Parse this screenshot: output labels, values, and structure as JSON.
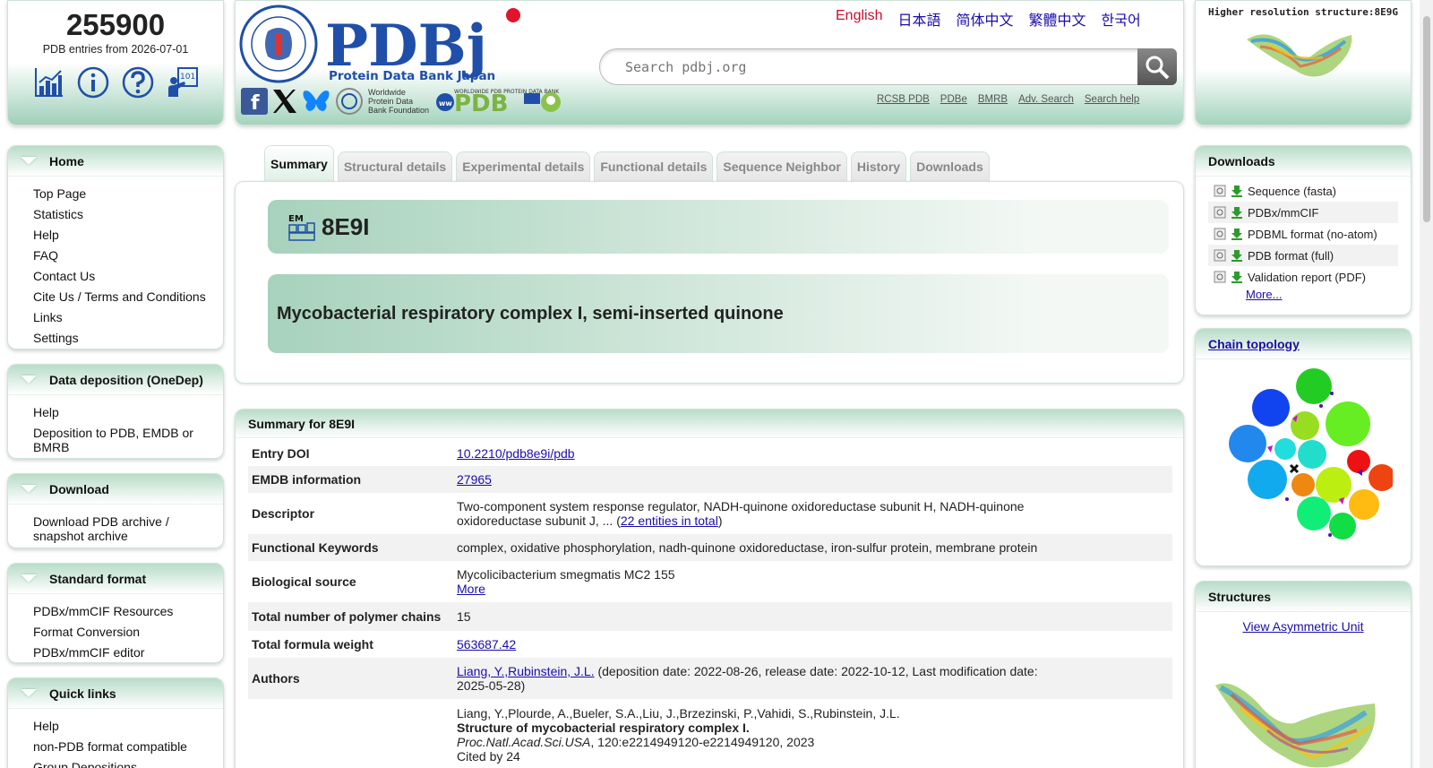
{
  "stats": {
    "count": "255900",
    "subtitle": "PDB entries from 2026-07-01"
  },
  "header": {
    "logo_text": "PDBj",
    "logo_sub": "Protein Data Bank Japan",
    "seal_text": "PROTEIN DATA BANK JAPAN · THE UNIVERSITY OF OSAKA",
    "wwpdb_foundation": "Worldwide Protein Data Bank Foundation",
    "wwpdb_logo": "WORLDWIDE PDB PROTEIN DATA BANK",
    "languages": [
      "English",
      "日本語",
      "简体中文",
      "繁體中文",
      "한국어"
    ],
    "search_placeholder": "Search pdbj.org",
    "sublinks": [
      "RCSB PDB",
      "PDBe",
      "BMRB",
      "Adv. Search",
      "Search help"
    ]
  },
  "hires": {
    "title": "Higher resolution structure:8E9G"
  },
  "menus": [
    {
      "title": "Home",
      "items": [
        "Top Page",
        "Statistics",
        "Help",
        "FAQ",
        "Contact Us",
        "Cite Us / Terms and Conditions",
        "Links",
        "Settings"
      ]
    },
    {
      "title": "Data deposition (OneDep)",
      "items": [
        "Help",
        "Deposition to PDB, EMDB or BMRB"
      ]
    },
    {
      "title": "Download",
      "items": [
        "Download PDB archive / snapshot archive"
      ]
    },
    {
      "title": "Standard format",
      "items": [
        "PDBx/mmCIF Resources",
        "Format Conversion",
        "PDBx/mmCIF editor"
      ]
    },
    {
      "title": "Quick links",
      "items": [
        "Help",
        "non-PDB format compatible",
        "Group Depositions"
      ]
    }
  ],
  "tabs": [
    "Summary",
    "Structural details",
    "Experimental details",
    "Functional details",
    "Sequence Neighbor",
    "History",
    "Downloads"
  ],
  "entry": {
    "method_icon_label": "EM",
    "id": "8E9I",
    "title": "Mycobacterial respiratory complex I, semi-inserted quinone"
  },
  "summary": {
    "heading": "Summary for 8E9I",
    "rows": {
      "doi_label": "Entry DOI",
      "doi": "10.2210/pdb8e9i/pdb",
      "emdb_label": "EMDB information",
      "emdb": "27965",
      "descriptor_label": "Descriptor",
      "descriptor": "Two-component system response regulator, NADH-quinone oxidoreductase subunit H, NADH-quinone oxidoreductase subunit J, ... (",
      "descriptor_link": "22 entities in total",
      "descriptor_end": ")",
      "keywords_label": "Functional Keywords",
      "keywords": "complex, oxidative phosphorylation, nadh-quinone oxidoreductase, iron-sulfur protein, membrane protein",
      "source_label": "Biological source",
      "source": "Mycolicibacterium smegmatis MC2 155",
      "source_more": "More",
      "chains_label": "Total number of polymer chains",
      "chains": "15",
      "weight_label": "Total formula weight",
      "weight": "563687.42",
      "authors_label": "Authors",
      "authors_links": "Liang, Y.,Rubinstein, J.L.",
      "authors_dates": " (deposition date: 2022-08-26, release date: 2022-10-12, Last modification date: 2025-05-28)",
      "cite_authors": "Liang, Y.,Plourde, A.,Bueler, S.A.,Liu, J.,Brzezinski, P.,Vahidi, S.,Rubinstein, J.L.",
      "cite_title": "Structure of mycobacterial respiratory complex I.",
      "cite_journal": "Proc.Natl.Acad.Sci.USA",
      "cite_pages": ", 120:e2214949120-e2214949120, 2023",
      "cite_count": "Cited by 24"
    }
  },
  "downloads": {
    "title": "Downloads",
    "items": [
      "Sequence (fasta)",
      "PDBx/mmCIF",
      "PDBML format (no-atom)",
      "PDB format (full)",
      "Validation report (PDF)"
    ],
    "more": "More..."
  },
  "chain_topology": {
    "title": "Chain topology"
  },
  "structures": {
    "title": "Structures",
    "link": "View Asymmetric Unit"
  },
  "colors": {
    "accent": "#a3d3bd",
    "link": "#1a0dab",
    "active_lang": "#c8102e",
    "logo_blue": "#1f4fa8"
  }
}
